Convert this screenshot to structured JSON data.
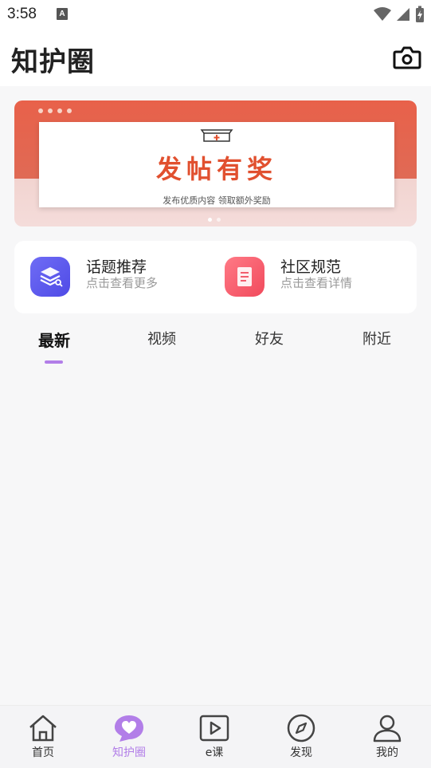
{
  "status": {
    "time": "3:58",
    "notif": "A"
  },
  "header": {
    "title": "知护圈"
  },
  "banner": {
    "title": "发帖有奖",
    "subtitle": "发布优质内容   领取额外奖励"
  },
  "quick": [
    {
      "title": "话题推荐",
      "sub": "点击查看更多"
    },
    {
      "title": "社区规范",
      "sub": "点击查看详情"
    }
  ],
  "tabs": [
    "最新",
    "视频",
    "好友",
    "附近"
  ],
  "active_tab": "最新",
  "nav": [
    {
      "label": "首页",
      "icon": "home-icon"
    },
    {
      "label": "知护圈",
      "icon": "heart-chat-icon"
    },
    {
      "label": "e课",
      "icon": "play-icon"
    },
    {
      "label": "发现",
      "icon": "compass-icon"
    },
    {
      "label": "我的",
      "icon": "user-icon"
    }
  ],
  "colors": {
    "accent": "#b27ee8",
    "banner": "#e8614a",
    "banner_text": "#e1502f"
  }
}
